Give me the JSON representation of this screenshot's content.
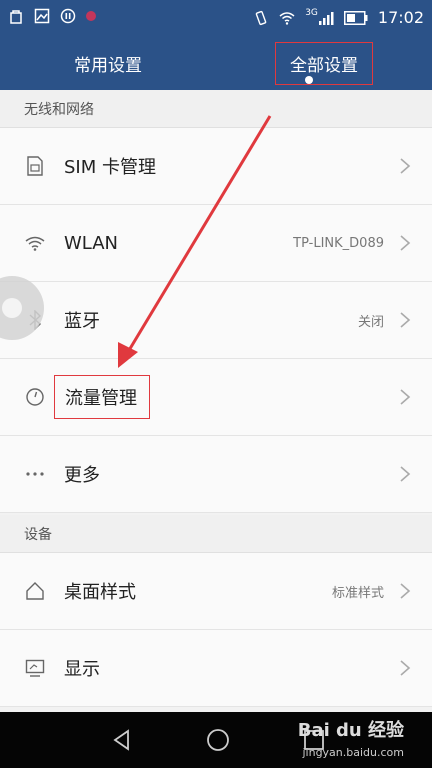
{
  "status_bar": {
    "time": "17:02",
    "network": "3G",
    "icons": [
      "bag-icon",
      "image-icon",
      "pause-icon",
      "record-dot-icon",
      "vibrate-icon",
      "wifi-icon",
      "signal-icon",
      "battery-icon"
    ]
  },
  "tabs": [
    {
      "label": "常用设置"
    },
    {
      "label": "全部设置"
    }
  ],
  "sections": [
    {
      "header": "无线和网络",
      "items": [
        {
          "label": "SIM 卡管理",
          "value": "",
          "icon": "sim-icon"
        },
        {
          "label": "WLAN",
          "value": "TP-LINK_D089",
          "icon": "wifi-icon"
        },
        {
          "label": "蓝牙",
          "value": "关闭",
          "icon": "bluetooth-icon"
        },
        {
          "label": "流量管理",
          "value": "",
          "icon": "data-gauge-icon"
        },
        {
          "label": "更多",
          "value": "",
          "icon": "more-icon"
        }
      ]
    },
    {
      "header": "设备",
      "items": [
        {
          "label": "桌面样式",
          "value": "标准样式",
          "icon": "home-icon"
        },
        {
          "label": "显示",
          "value": "",
          "icon": "display-icon"
        }
      ]
    }
  ],
  "watermark": {
    "text": "Bai du 经验",
    "url": "jingyan.baidu.com"
  },
  "colors": {
    "header_bg": "#2b5288",
    "highlight": "#e0393e",
    "arrow": "#e0393e"
  }
}
